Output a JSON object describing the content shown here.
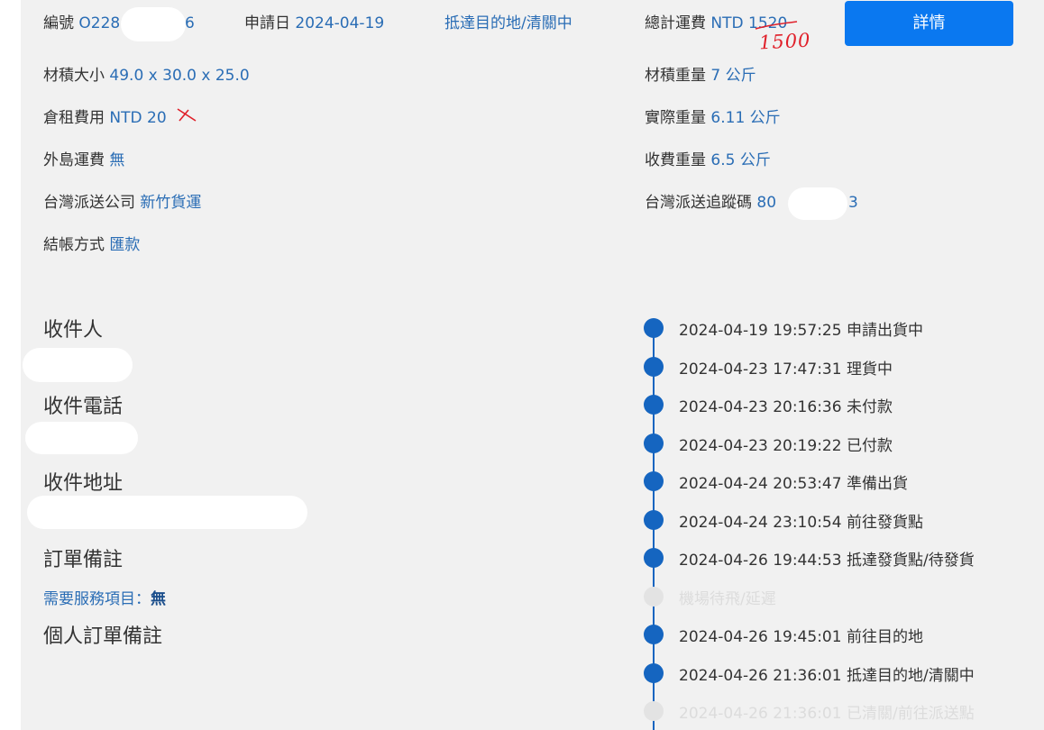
{
  "header": {
    "order_no_label": "編號",
    "order_no_prefix": "O228",
    "order_no_suffix": "6",
    "apply_date_label": "申請日",
    "apply_date": "2024-04-19",
    "status": "抵達目的地/清關中",
    "total_fee_label": "總計運費",
    "total_fee_currency": "NTD",
    "total_fee_original": "1520",
    "total_fee_handwritten": "1500",
    "details_button": "詳情"
  },
  "details": {
    "size_label": "材積大小",
    "size_value": "49.0 x 30.0 x 25.0",
    "storage_fee_label": "倉租費用",
    "storage_fee_value": "NTD 20",
    "island_fee_label": "外島運費",
    "island_fee_value": "無",
    "tw_courier_label": "台灣派送公司",
    "tw_courier_value": "新竹貨運",
    "payment_label": "結帳方式",
    "payment_value": "匯款",
    "volume_weight_label": "材積重量",
    "volume_weight_value": "7 公斤",
    "actual_weight_label": "實際重量",
    "actual_weight_value": "6.11 公斤",
    "charge_weight_label": "收費重量",
    "charge_weight_value": "6.5 公斤",
    "tracking_label": "台灣派送追蹤碼",
    "tracking_prefix": "80",
    "tracking_suffix": "3"
  },
  "recipient": {
    "name_label": "收件人",
    "phone_label": "收件電話",
    "address_label": "收件地址",
    "order_note_label": "訂單備註",
    "service_items_label": "需要服務項目：",
    "service_items_value": "無",
    "personal_note_label": "個人訂單備註"
  },
  "timeline": [
    {
      "datetime": "2024-04-19 19:57:25",
      "status": "申請出貨中",
      "active": true
    },
    {
      "datetime": "2024-04-23 17:47:31",
      "status": "理貨中",
      "active": true
    },
    {
      "datetime": "2024-04-23 20:16:36",
      "status": "未付款",
      "active": true
    },
    {
      "datetime": "2024-04-23 20:19:22",
      "status": "已付款",
      "active": true
    },
    {
      "datetime": "2024-04-24 20:53:47",
      "status": "準備出貨",
      "active": true
    },
    {
      "datetime": "2024-04-24 23:10:54",
      "status": "前往發貨點",
      "active": true
    },
    {
      "datetime": "2024-04-26 19:44:53",
      "status": "抵達發貨點/待發貨",
      "active": true
    },
    {
      "datetime": "",
      "status": "機場待飛/延遲",
      "active": false
    },
    {
      "datetime": "2024-04-26 19:45:01",
      "status": "前往目的地",
      "active": true
    },
    {
      "datetime": "2024-04-26 21:36:01",
      "status": "抵達目的地/清關中",
      "active": true
    },
    {
      "datetime": "2024-04-26 21:36:01",
      "status": "已清關/前往派送點",
      "active": false
    }
  ],
  "colors": {
    "accent": "#0a78f0",
    "value_text": "#2a6db5",
    "timeline": "#1565c0",
    "annotation_red": "#e0202a",
    "panel_bg": "#f1f1f1"
  }
}
